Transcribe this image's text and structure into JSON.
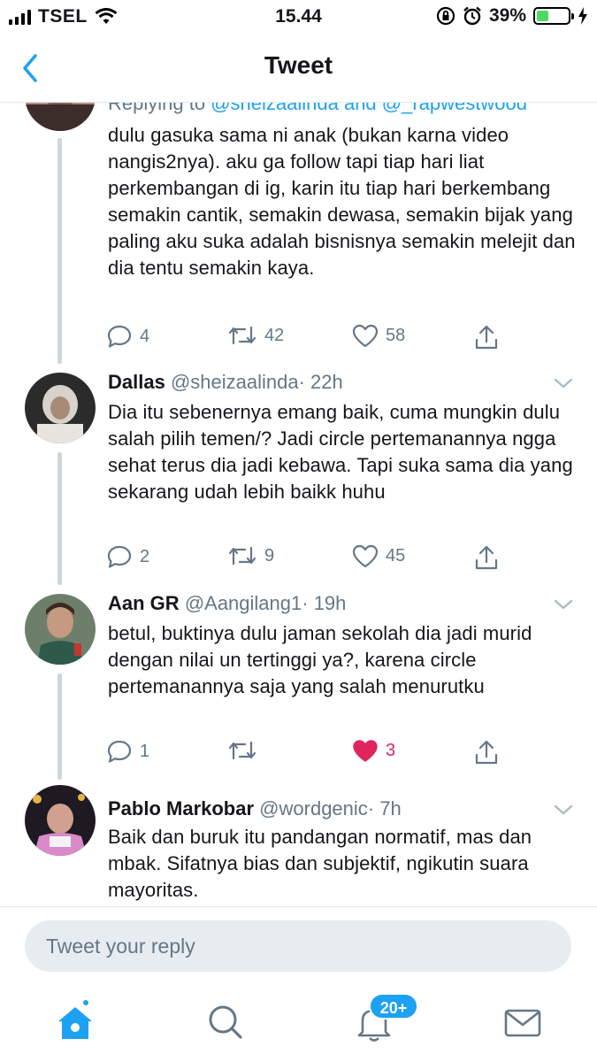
{
  "status_bar": {
    "carrier": "TSEL",
    "time": "15.44",
    "battery_percent": "39%",
    "battery_level": 0.39
  },
  "header": {
    "title": "Tweet",
    "back_icon": "chevron-left-icon"
  },
  "tweets": [
    {
      "replying_to_prefix": "Replying to",
      "replying_to_handles": "@sheizaalinda and @_rapwestwood",
      "text": "dulu gasuka sama ni anak (bukan karna video nangis2nya). aku ga follow tapi tiap hari liat perkembangan di ig, karin itu tiap hari berkembang semakin cantik, semakin dewasa, semakin bijak yang paling aku suka adalah bisnisnya semakin melejit dan dia tentu semakin kaya.",
      "replies": "4",
      "retweets": "42",
      "likes": "58",
      "liked": false
    },
    {
      "name": "Dallas",
      "handle": "@sheizaalinda",
      "time": "· 22h",
      "text": "Dia itu sebenernya emang baik, cuma mungkin dulu salah pilih temen/? Jadi circle pertemanannya ngga sehat terus dia jadi kebawa. Tapi suka sama dia yang sekarang udah lebih baikk huhu",
      "replies": "2",
      "retweets": "9",
      "likes": "45",
      "liked": false
    },
    {
      "name": "Aan GR",
      "handle": "@Aangilang1",
      "time": "· 19h",
      "text": "betul, buktinya dulu jaman sekolah dia jadi murid dengan nilai un tertinggi ya?, karena circle pertemanannya saja yang salah menurutku",
      "replies": "1",
      "retweets": "",
      "likes": "3",
      "liked": true
    },
    {
      "name": "Pablo Markobar",
      "handle": "@wordgenic",
      "time": "· 7h",
      "text": "Baik dan buruk itu pandangan normatif, mas dan mbak. Sifatnya bias dan subjektif, ngikutin suara mayoritas."
    }
  ],
  "reply_bar": {
    "placeholder": "Tweet your reply"
  },
  "tabbar": {
    "notifications_badge": "20+",
    "tabs": [
      "home-icon",
      "search-icon",
      "bell-icon",
      "mail-icon"
    ]
  },
  "colors": {
    "accent": "#1da1f2",
    "like": "#e0245e",
    "muted": "#657786"
  }
}
